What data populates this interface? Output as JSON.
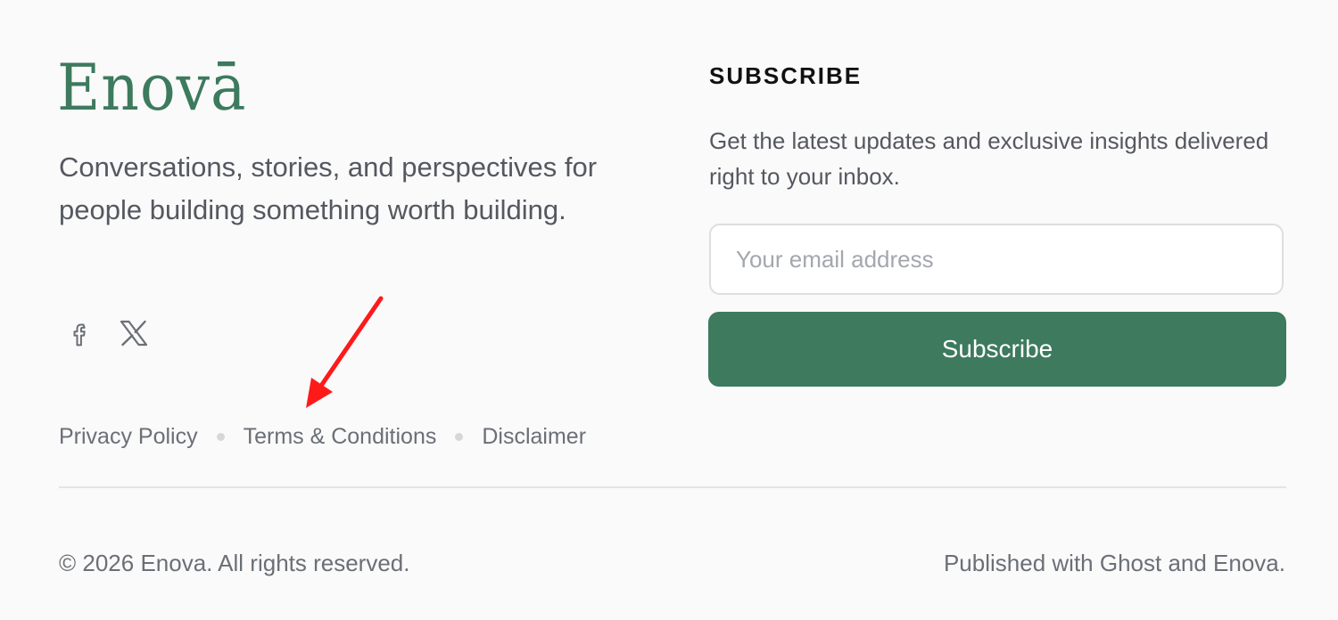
{
  "brand": {
    "logo_text": "Enovā",
    "tagline": "Conversations, stories, and perspectives for people building something worth building.",
    "color": "#3d7a5e"
  },
  "social": [
    {
      "icon": "facebook-icon"
    },
    {
      "icon": "x-twitter-icon"
    }
  ],
  "legal_links": [
    "Privacy Policy",
    "Terms & Conditions",
    "Disclaimer"
  ],
  "subscribe": {
    "title": "SUBSCRIBE",
    "description": "Get the latest updates and exclusive insights delivered right to your inbox.",
    "email_placeholder": "Your email address",
    "button_label": "Subscribe",
    "button_color": "#3d7a5e"
  },
  "footer": {
    "copyright": "© 2026 Enova. All rights reserved.",
    "published": "Published with Ghost and Enova."
  },
  "annotation": {
    "color": "#ff1a1a",
    "icon": "red-arrow-icon"
  }
}
